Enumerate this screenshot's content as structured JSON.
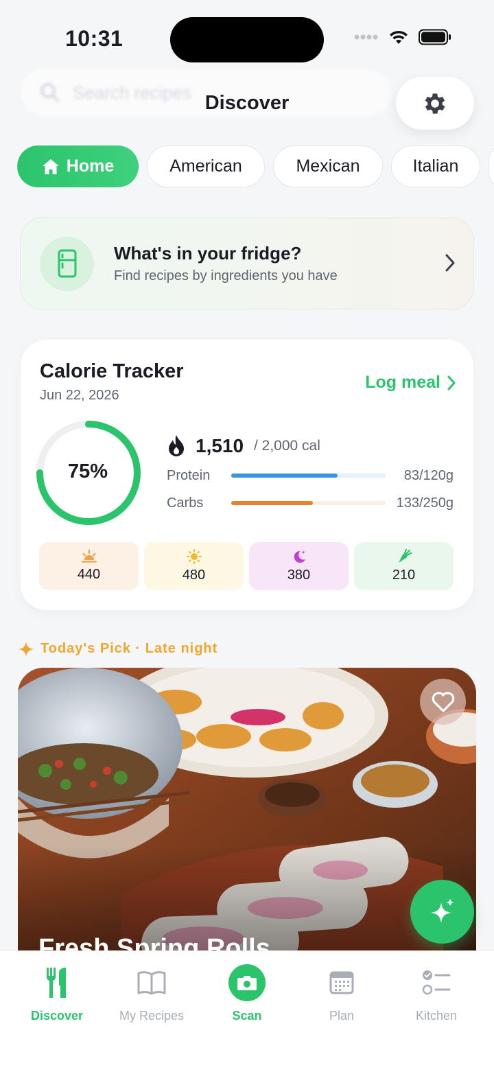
{
  "status_bar": {
    "time": "10:31"
  },
  "header": {
    "title": "Discover",
    "search_placeholder": "Search recipes"
  },
  "chips": [
    {
      "label": "Home",
      "icon": "home-icon",
      "active": true
    },
    {
      "label": "American",
      "active": false
    },
    {
      "label": "Mexican",
      "active": false
    },
    {
      "label": "Italian",
      "active": false
    }
  ],
  "fridge_card": {
    "title": "What's in your fridge?",
    "subtitle": "Find recipes by ingredients you have",
    "icon": "fridge-icon"
  },
  "calorie_tracker": {
    "title": "Calorie Tracker",
    "date": "Jun 22, 2026",
    "log_meal_label": "Log meal",
    "progress_pct": "75%",
    "progress_fraction": 0.75,
    "calories": "1,510",
    "goal": "/ 2,000 cal",
    "macros": [
      {
        "label": "Protein",
        "value": "83/120g",
        "fraction": 0.69,
        "color": "#3a95dd",
        "track": "#e4f0fb"
      },
      {
        "label": "Carbs",
        "value": "133/250g",
        "fraction": 0.53,
        "color": "#e8822e",
        "track": "#fbeee3"
      }
    ],
    "meals": [
      {
        "name": "breakfast",
        "icon": "sunrise-icon",
        "value": "440",
        "bg": "#fdf1e6",
        "color": "#f0a04b"
      },
      {
        "name": "lunch",
        "icon": "sun-icon",
        "value": "480",
        "bg": "#fdf7e3",
        "color": "#f5b92a"
      },
      {
        "name": "dinner",
        "icon": "moon-icon",
        "value": "380",
        "bg": "#f8e6f8",
        "color": "#c23ed6"
      },
      {
        "name": "snack",
        "icon": "carrot-icon",
        "value": "210",
        "bg": "#eaf7ed",
        "color": "#2bc46c"
      }
    ]
  },
  "todays_pick": {
    "label": "Today's Pick · Late night",
    "recipe_title": "Fresh Spring Rolls"
  },
  "bottom_nav": [
    {
      "label": "Discover",
      "icon": "fork-knife-icon",
      "active": true
    },
    {
      "label": "My Recipes",
      "icon": "book-icon",
      "active": false
    },
    {
      "label": "Scan",
      "icon": "camera-icon",
      "active": true
    },
    {
      "label": "Plan",
      "icon": "calendar-icon",
      "active": false
    },
    {
      "label": "Kitchen",
      "icon": "checklist-icon",
      "active": false
    }
  ],
  "colors": {
    "accent": "#2bc46c",
    "pick": "#f0a52b",
    "background": "#f5f6f8"
  }
}
